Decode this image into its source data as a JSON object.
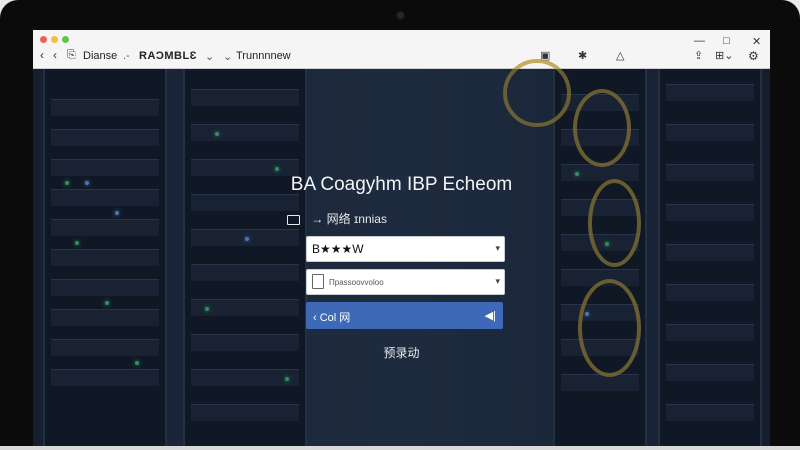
{
  "browser": {
    "tab_prefix": "Dianse",
    "tab_title": "RAƆMBLƐ",
    "tab_extra": "Trunnnnew",
    "icons": {
      "back": "chevron-left-icon",
      "forward": "chevron-right-icon",
      "download": "download-icon",
      "pin": "pin-icon",
      "alert": "triangle-icon",
      "share": "share-icon",
      "grid": "grid-icon",
      "settings": "gear-icon"
    }
  },
  "login": {
    "title": "BA Coagyhm IBP Echeom",
    "subtitle": "→ 网络 ɪnnias",
    "username_value": "B★★★W",
    "password_placeholder": "Пpassoovvoloo",
    "submit_label": "‹ Cοl 网",
    "link_text": "预录动"
  },
  "colors": {
    "accent": "#3e69b6",
    "page_bg": "#1b2535"
  }
}
